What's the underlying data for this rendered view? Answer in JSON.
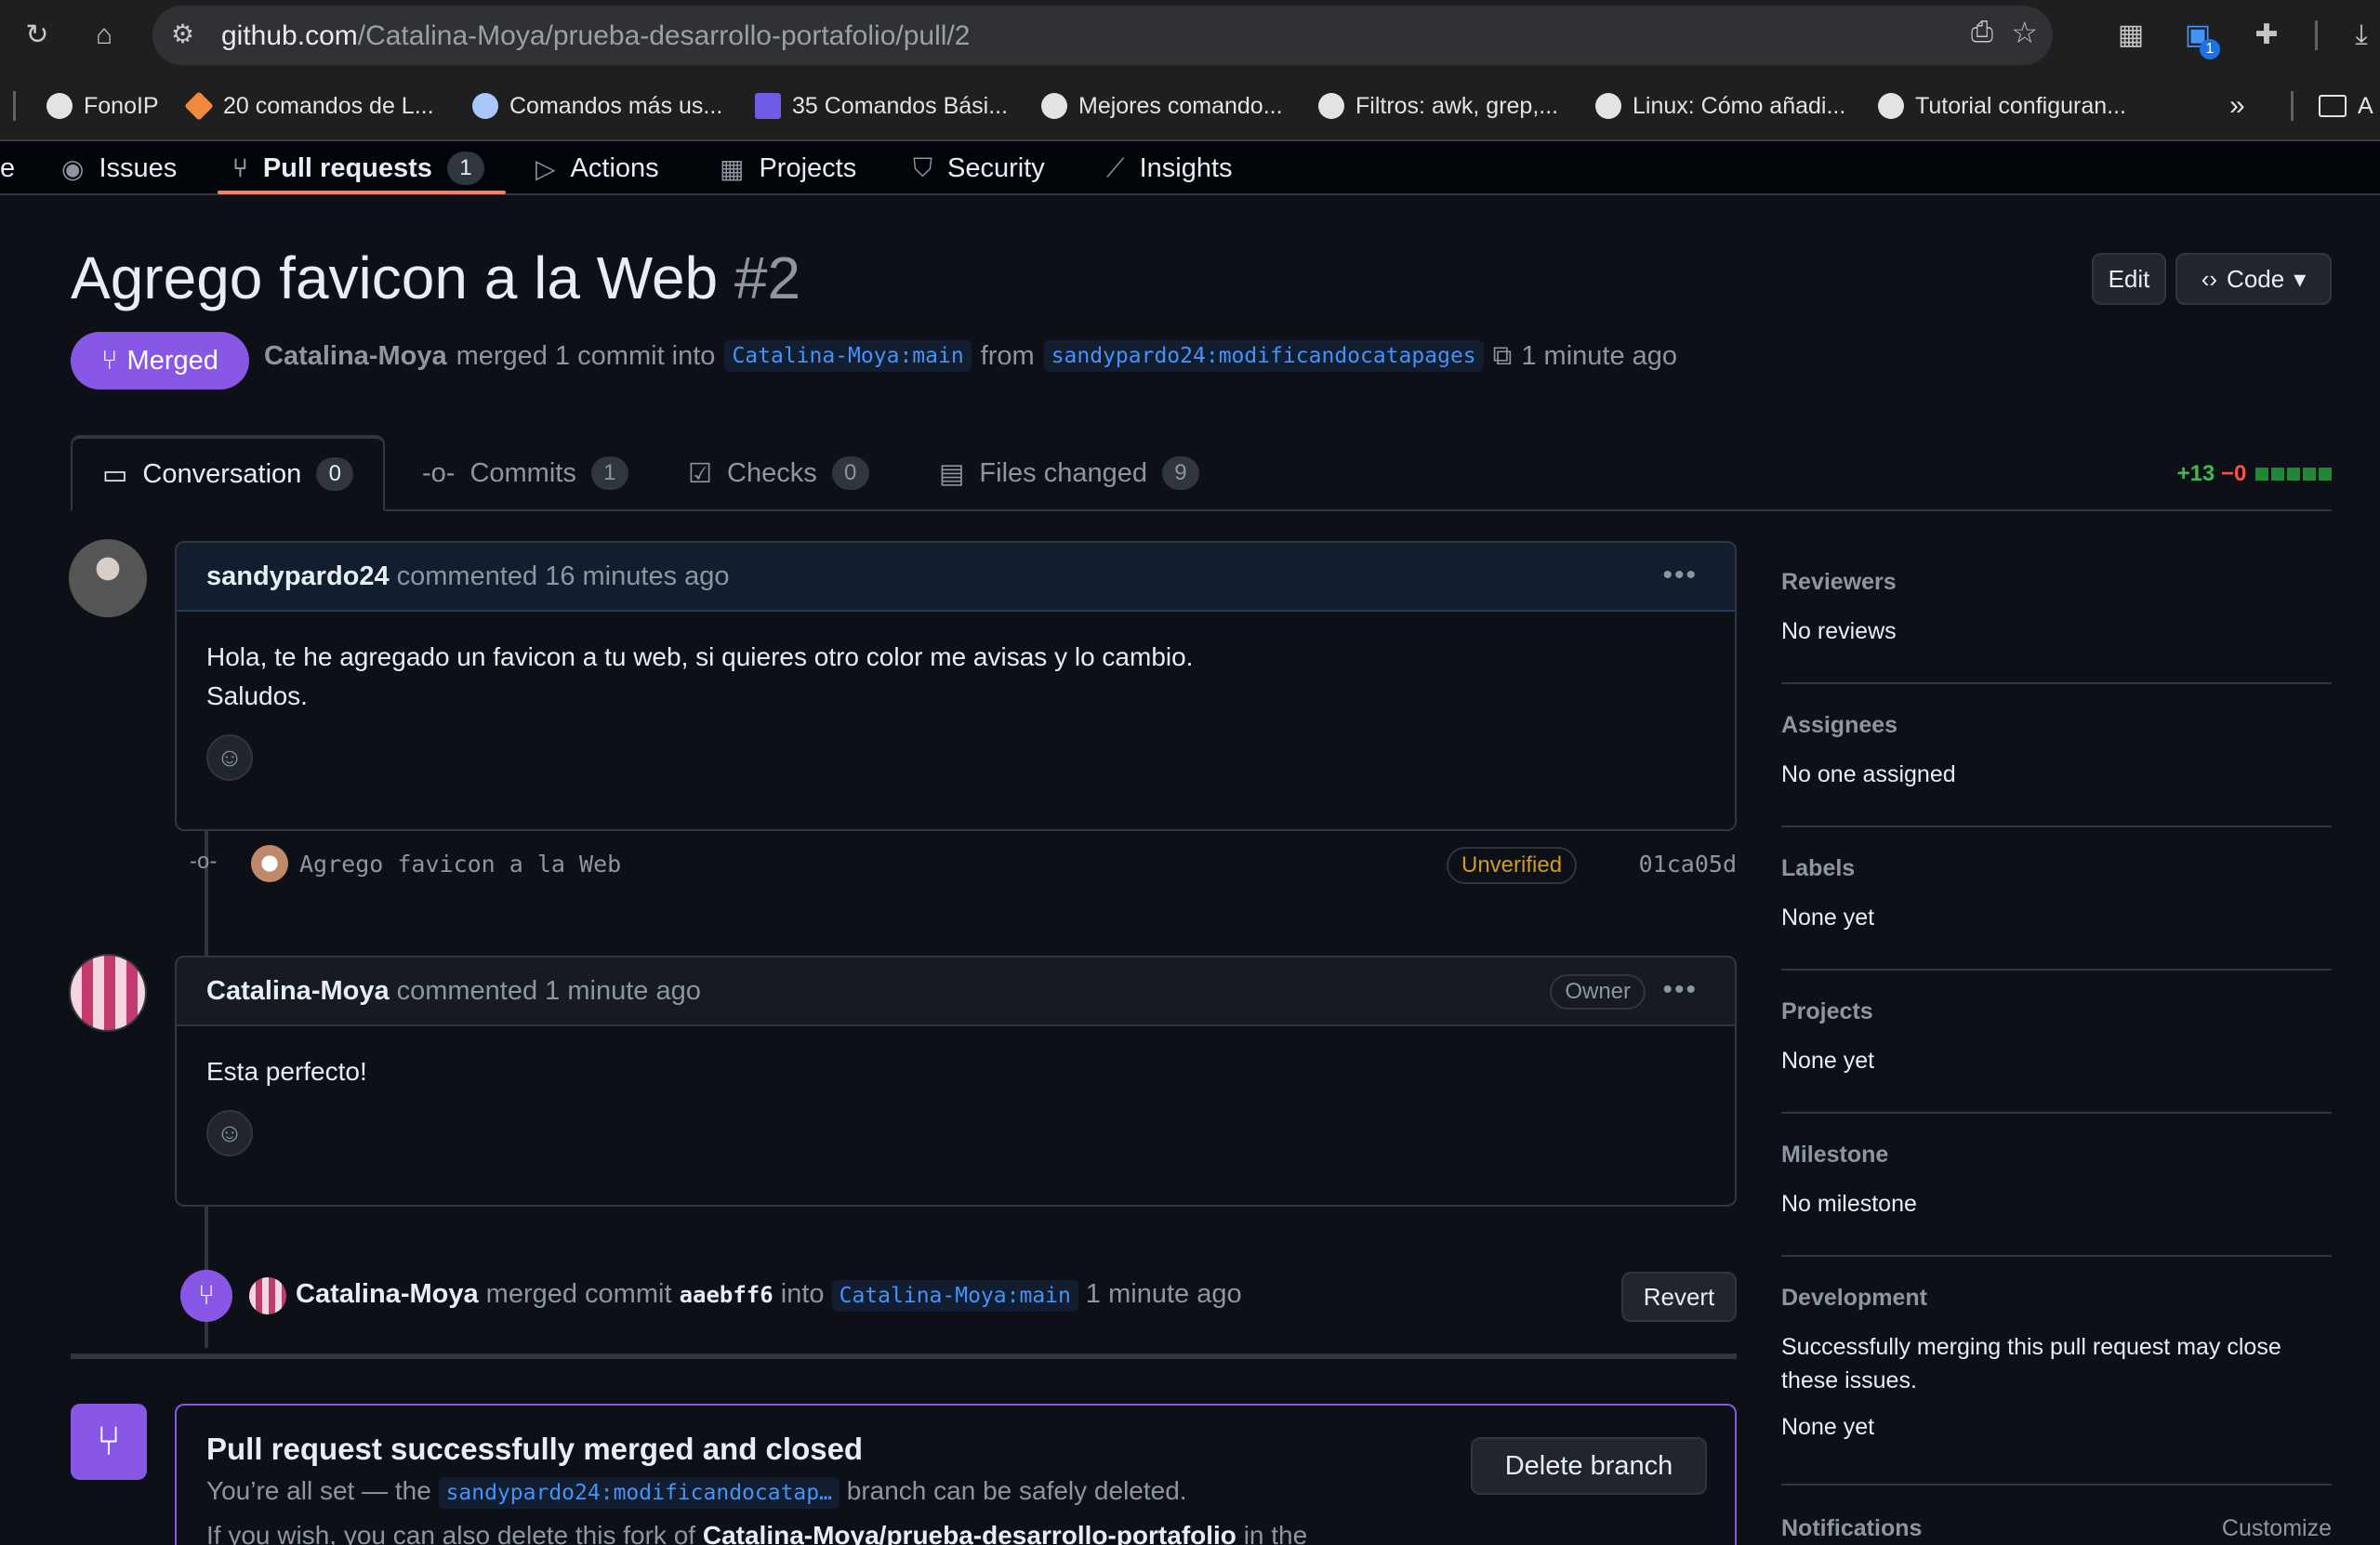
{
  "browser": {
    "url_host": "github.com",
    "url_path": "/Catalina-Moya/prueba-desarrollo-portafolio/pull/2",
    "bookmarks": [
      "FonoIP",
      "20 comandos de L...",
      "Comandos más us...",
      "35 Comandos Bási...",
      "Mejores comando...",
      "Filtros: awk, grep,...",
      "Linux: Cómo añadi...",
      "Tutorial configuran..."
    ],
    "bookmarks_overflow": "»",
    "bookmark_folder_initial": "A",
    "extension_badge": "1"
  },
  "repo_nav": {
    "partial_item": "e",
    "items": [
      {
        "label": "Issues",
        "icon": "issue-icon"
      },
      {
        "label": "Pull requests",
        "icon": "pull-request-icon",
        "count": "1",
        "active": true
      },
      {
        "label": "Actions",
        "icon": "play-icon"
      },
      {
        "label": "Projects",
        "icon": "table-icon"
      },
      {
        "label": "Security",
        "icon": "shield-icon"
      },
      {
        "label": "Insights",
        "icon": "graph-icon"
      }
    ]
  },
  "pr": {
    "title": "Agrego favicon a la Web",
    "number": "#2",
    "edit_label": "Edit",
    "code_label": "Code",
    "status": "Merged",
    "merger": "Catalina-Moya",
    "meta_text": "merged 1 commit into",
    "base_branch": "Catalina-Moya:main",
    "from_text": "from",
    "head_branch": "sandypardo24:modificandocatapages",
    "time": "1 minute ago"
  },
  "tabs": [
    {
      "label": "Conversation",
      "count": "0",
      "icon": "comment-icon"
    },
    {
      "label": "Commits",
      "count": "1",
      "icon": "commit-icon"
    },
    {
      "label": "Checks",
      "count": "0",
      "icon": "checklist-icon"
    },
    {
      "label": "Files changed",
      "count": "9",
      "icon": "file-diff-icon"
    }
  ],
  "diffstat": {
    "additions": "+13",
    "deletions": "−0"
  },
  "comments": [
    {
      "author": "sandypardo24",
      "meta": "commented 16 minutes ago",
      "body_lines": [
        "Hola, te he agregado un favicon a tu web, si quieres otro color me avisas y lo cambio.",
        "Saludos."
      ]
    },
    {
      "author": "Catalina-Moya",
      "meta": "commented 1 minute ago",
      "badge": "Owner",
      "body_lines": [
        "Esta perfecto!"
      ]
    }
  ],
  "commit": {
    "message": "Agrego favicon a la Web",
    "verification": "Unverified",
    "sha": "01ca05d"
  },
  "merge_event": {
    "actor": "Catalina-Moya",
    "text": "merged commit",
    "sha": "aaebff6",
    "into_text": "into",
    "branch": "Catalina-Moya:main",
    "time": "1 minute ago",
    "revert_label": "Revert"
  },
  "merged_box": {
    "title": "Pull request successfully merged and closed",
    "line1_before": "You’re all set — the",
    "branch": "sandypardo24:modificandocatap…",
    "line1_after": "branch can be safely deleted.",
    "line2_before": "If you wish, you can also delete this fork of",
    "line2_repo": "Catalina-Moya/prueba-desarrollo-portafolio",
    "line2_after": "in the",
    "delete_label": "Delete branch"
  },
  "sidebar": [
    {
      "title": "Reviewers",
      "value": "No reviews"
    },
    {
      "title": "Assignees",
      "value": "No one assigned"
    },
    {
      "title": "Labels",
      "value": "None yet"
    },
    {
      "title": "Projects",
      "value": "None yet"
    },
    {
      "title": "Milestone",
      "value": "No milestone"
    },
    {
      "title": "Development",
      "value": "Successfully merging this pull request may close these issues.",
      "value2": "None yet"
    }
  ],
  "notifications": {
    "title": "Notifications",
    "action": "Customize"
  },
  "colors": {
    "merged": "#8957e5",
    "link": "#4493f8",
    "additions": "#3fb950",
    "deletions": "#f85149",
    "warning": "#d29922",
    "active_tab": "#f78166"
  }
}
